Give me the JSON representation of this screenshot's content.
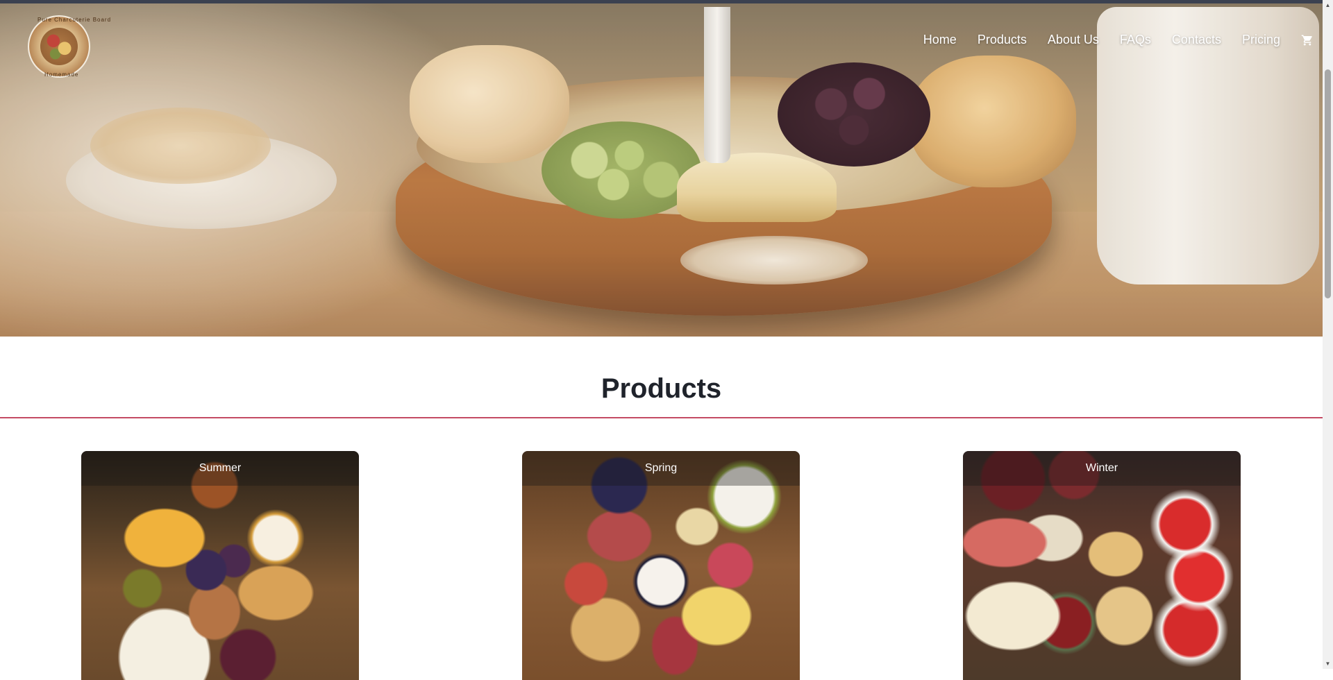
{
  "brand": {
    "logo_icon": "charcuterie-board-logo",
    "logo_text_top": "Pure Charcuterie Board",
    "logo_text_bottom": "Homemade"
  },
  "nav": {
    "items": [
      {
        "label": "Home"
      },
      {
        "label": "Products"
      },
      {
        "label": "About Us"
      },
      {
        "label": "FAQs"
      },
      {
        "label": "Contacts"
      },
      {
        "label": "Pricing"
      }
    ],
    "cart_icon": "shopping-cart-icon"
  },
  "hero": {
    "image": "charcuterie-tray-hero-image"
  },
  "products": {
    "title": "Products",
    "accent_color": "#c44a63",
    "cards": [
      {
        "label": "Summer",
        "image": "summer-charcuterie-board-image"
      },
      {
        "label": "Spring",
        "image": "spring-charcuterie-board-image"
      },
      {
        "label": "Winter",
        "image": "winter-charcuterie-board-image"
      }
    ]
  },
  "scrollbar": {
    "up_icon": "scroll-up-arrow-icon",
    "down_icon": "scroll-down-arrow-icon"
  }
}
